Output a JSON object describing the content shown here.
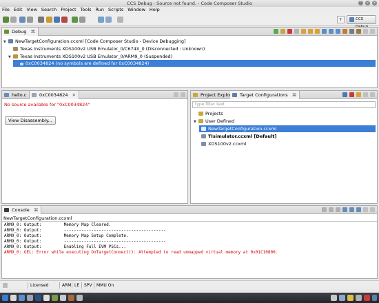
{
  "window": {
    "title": "CCS Debug - Source not found. - Code Composer Studio",
    "buttons": [
      "^",
      "v",
      "x"
    ]
  },
  "menu": [
    "File",
    "Edit",
    "View",
    "Search",
    "Project",
    "Tools",
    "Run",
    "Scripts",
    "Window",
    "Help"
  ],
  "toolbar": {
    "perspective_label": "CCS Debug",
    "open_perspective": "+"
  },
  "debug_view": {
    "tab_label": "Debug",
    "tab_close": "⌘",
    "tree": [
      {
        "label": "NewTargetConfiguration.ccxml [Code Composer Studio - Device Debugging]",
        "expanded": true
      },
      {
        "label": "Texas Instruments XDS100v2 USB Emulator_0/C674X_0 (Disconnected : Unknown)"
      },
      {
        "label": "Texas Instruments XDS100v2 USB Emulator_0/ARM9_0 (Suspended)",
        "expanded": true
      },
      {
        "label": "0xC0034824  (no symbols are defined for 0xC0034824)",
        "selected": true
      }
    ]
  },
  "editor": {
    "tabs": [
      {
        "label": "hello.c"
      },
      {
        "label": "0xC0034824",
        "active": true
      }
    ],
    "message": "No source available for \"0xC0034824\"",
    "button": "View Disassembly...",
    "colors": {
      "message": "#cc0000"
    }
  },
  "right_panel": {
    "tabs": [
      {
        "label": "Project Explorer"
      },
      {
        "label": "Target Configurations",
        "active": true
      }
    ],
    "filter_placeholder": "type filter text",
    "tree": [
      {
        "label": "Projects"
      },
      {
        "label": "User Defined",
        "expanded": true
      },
      {
        "label": "NewTargetConfiguration.ccxml",
        "selected": true
      },
      {
        "label": "TIsimulator.ccxml [Default]",
        "bold": true
      },
      {
        "label": "XDS100v2.ccxml"
      }
    ]
  },
  "console": {
    "tab_label": "Console",
    "header": "NewTargetConfiguration.ccxml",
    "lines": [
      {
        "text": "ARM9_0: Output:         Memory Map Cleared.",
        "error": false
      },
      {
        "text": "ARM9_0: Output:         -----------------------------------------",
        "error": false
      },
      {
        "text": "ARM9_0: Output:         Memory Map Setup Complete.",
        "error": false
      },
      {
        "text": "ARM9_0: Output:         -----------------------------------------",
        "error": false
      },
      {
        "text": "ARM9_0: Output:         Enabling Full EVM PSCs...",
        "error": false
      },
      {
        "text": "ARM9_0: GEL: Error while executing OnTargetConnect(): Attempted to read unmapped virtual memory at 0x01C10800.",
        "error": true
      }
    ],
    "colors": {
      "error": "#cc0000"
    }
  },
  "statusbar": {
    "items": [
      "Licensed",
      "ARM",
      "LE",
      "SPV",
      "MMU On"
    ]
  },
  "icons": {
    "debug_tab": "bug-icon",
    "launch": "gear-icon",
    "thread": "thread-icon",
    "frame": "stack-frame-icon",
    "folder": "folder-icon",
    "file": "ccxml-file-icon"
  }
}
